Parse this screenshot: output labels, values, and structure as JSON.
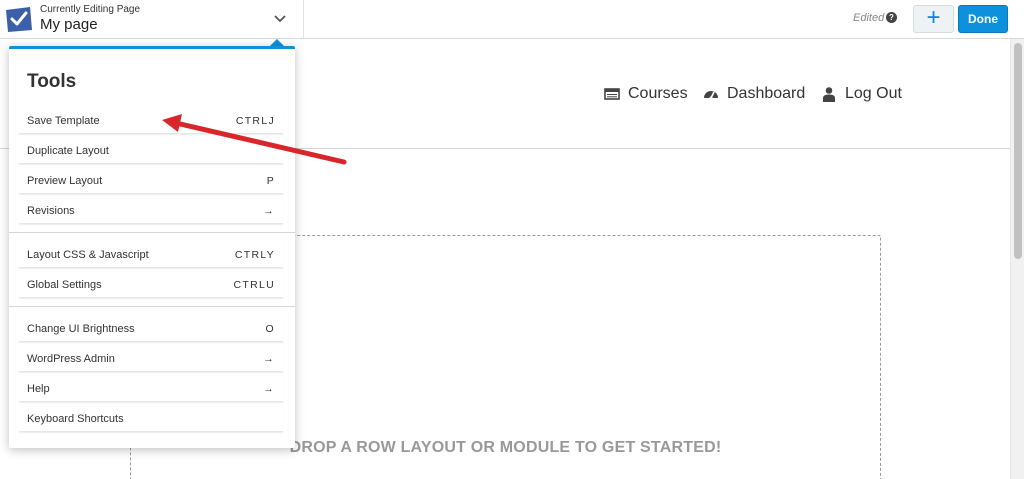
{
  "topbar": {
    "editing_label": "Currently Editing Page",
    "page_name": "My page",
    "status": "Edited",
    "help_glyph": "?",
    "add_glyph": "+",
    "done_label": "Done"
  },
  "nav": {
    "items": [
      {
        "label": "Courses",
        "icon": "courses-icon"
      },
      {
        "label": "Dashboard",
        "icon": "dashboard-icon"
      },
      {
        "label": "Log Out",
        "icon": "user-icon"
      }
    ]
  },
  "canvas": {
    "drop_text": "DROP A ROW LAYOUT OR MODULE TO GET STARTED!"
  },
  "tools": {
    "title": "Tools",
    "items": [
      {
        "label": "Save Template",
        "shortcut": "CTRLJ"
      },
      {
        "label": "Duplicate Layout",
        "shortcut": ""
      },
      {
        "label": "Preview Layout",
        "shortcut": "P"
      },
      {
        "label": "Revisions",
        "shortcut": "→"
      },
      {
        "label": "Layout CSS & Javascript",
        "shortcut": "CTRLY"
      },
      {
        "label": "Global Settings",
        "shortcut": "CTRLU"
      },
      {
        "label": "Change UI Brightness",
        "shortcut": "O"
      },
      {
        "label": "WordPress Admin",
        "shortcut": "→"
      },
      {
        "label": "Help",
        "shortcut": "→"
      },
      {
        "label": "Keyboard Shortcuts",
        "shortcut": ""
      }
    ]
  },
  "colors": {
    "accent": "#0e91dc",
    "arrow": "#d8262a"
  }
}
